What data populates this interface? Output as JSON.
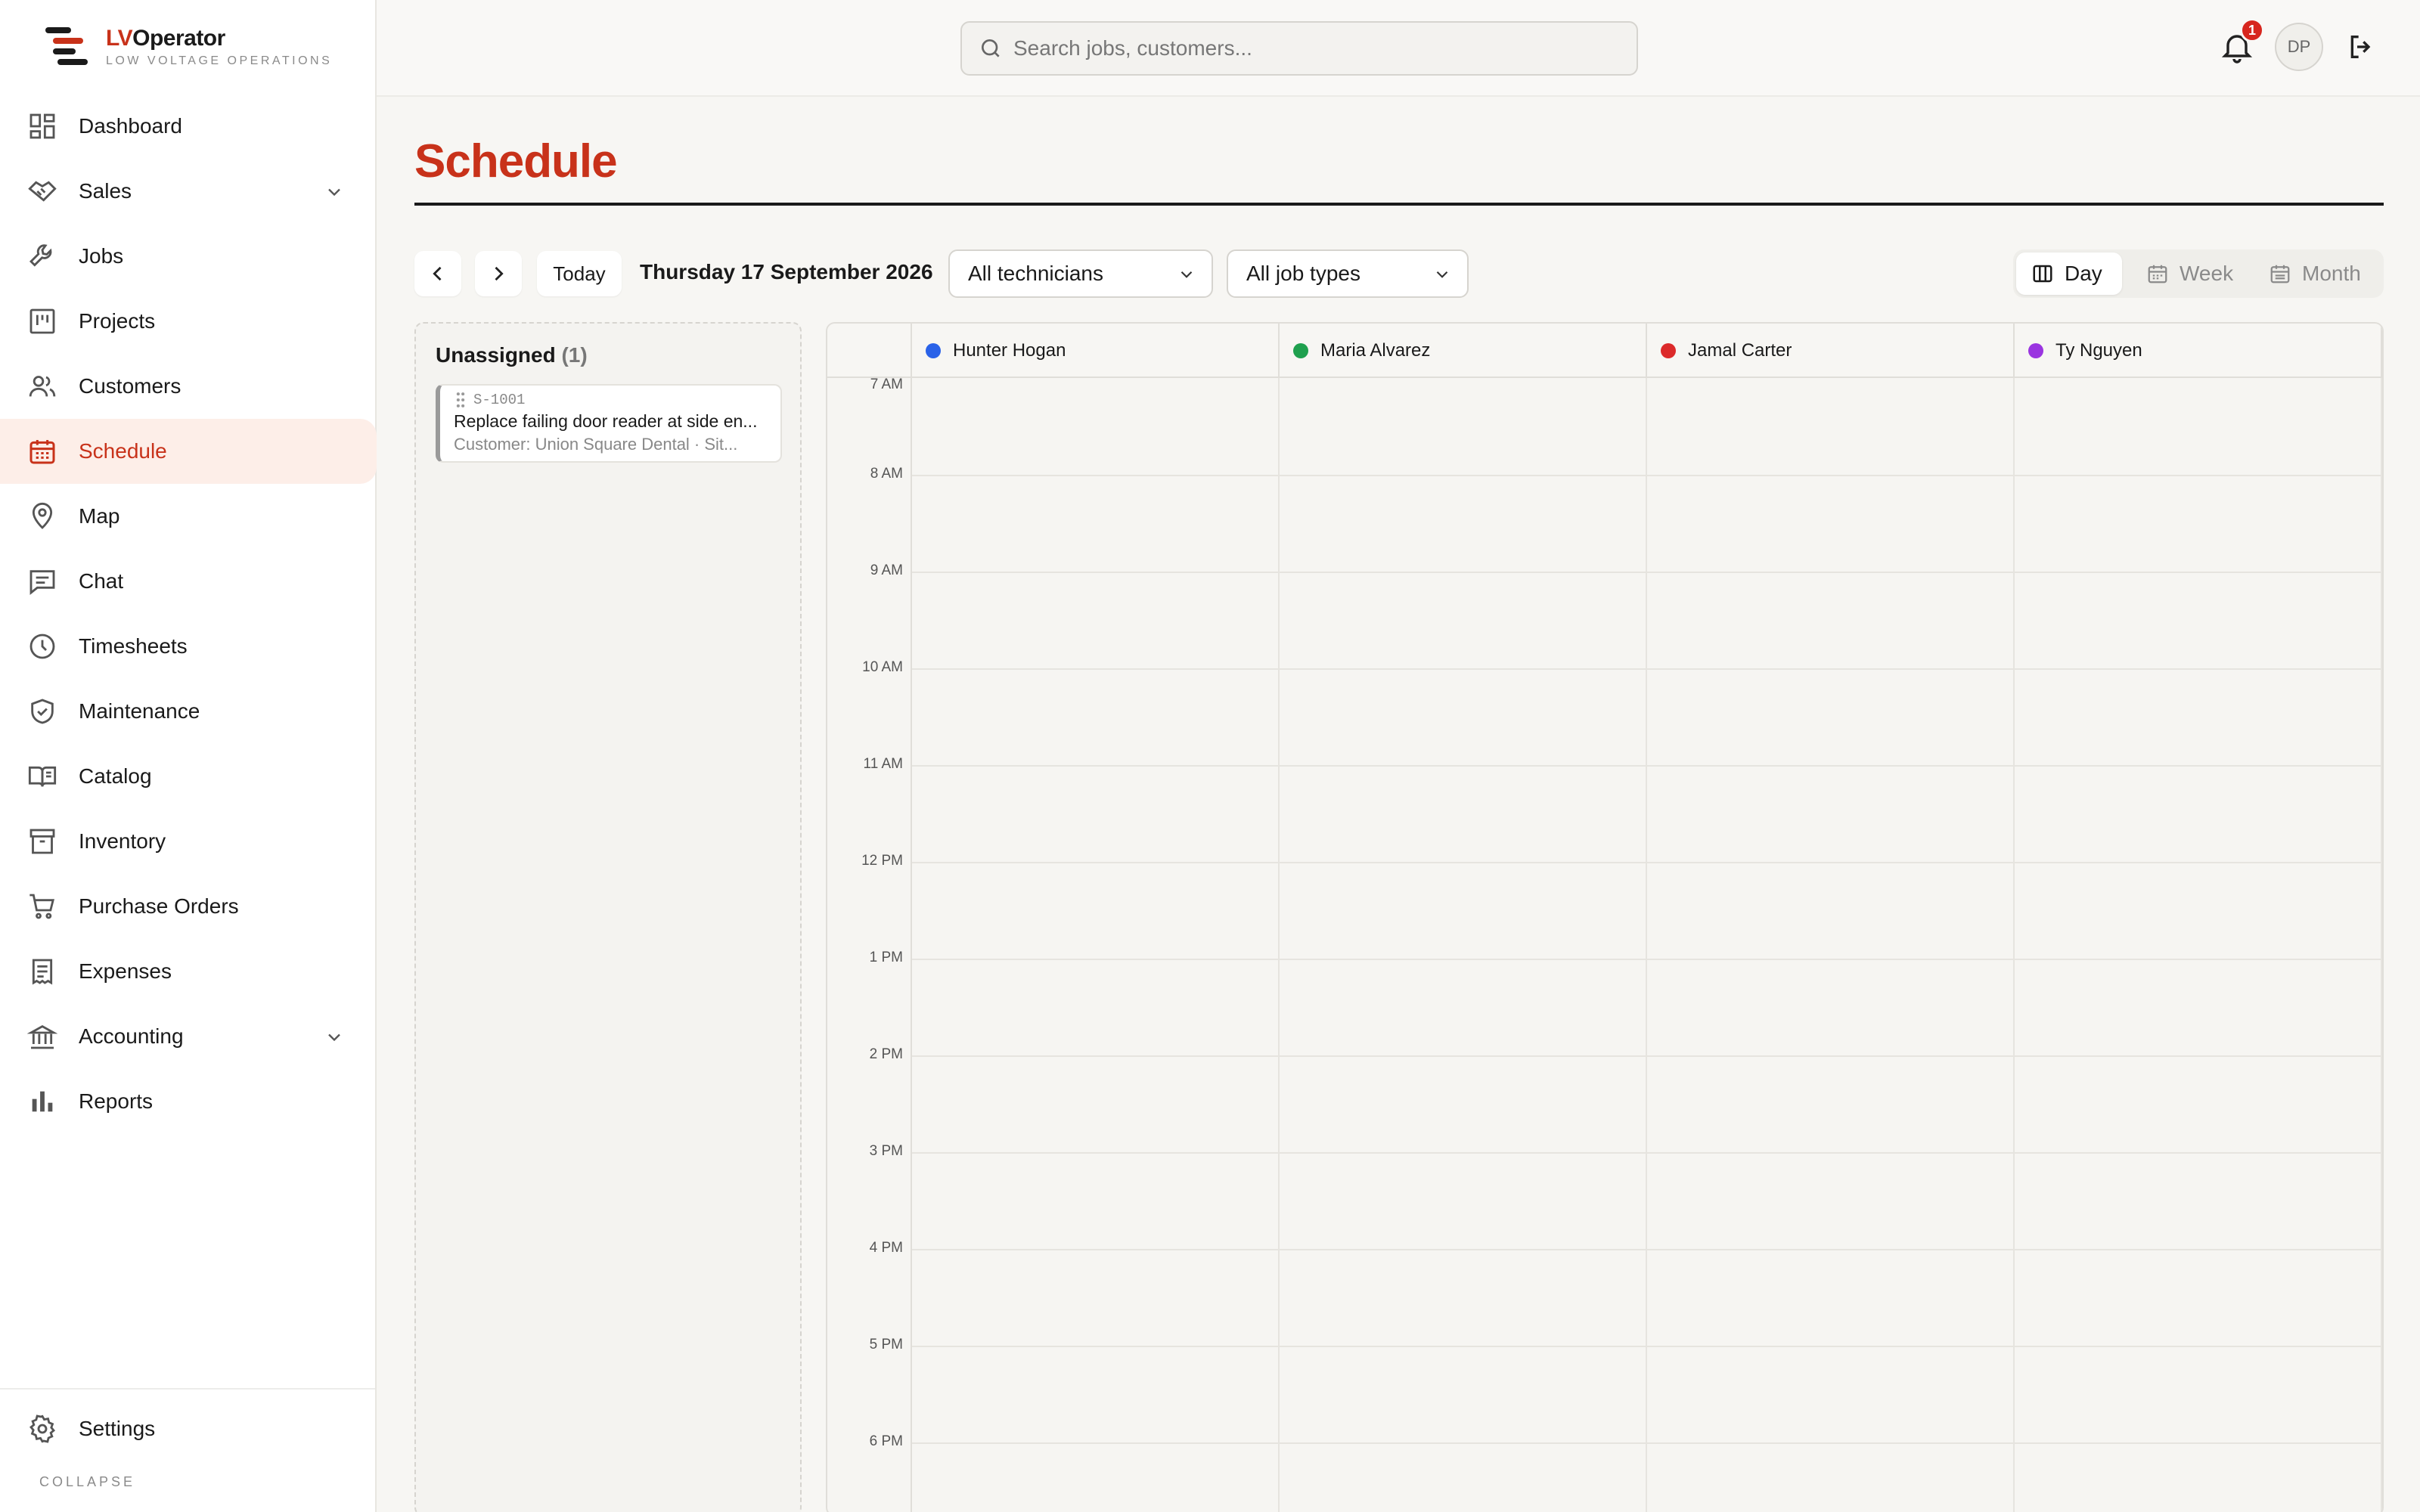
{
  "brand": {
    "name_prefix": "LV",
    "name_suffix": "Operator",
    "tagline": "LOW VOLTAGE OPERATIONS",
    "accent_color": "#c8321a"
  },
  "sidebar": {
    "items": [
      {
        "label": "Dashboard",
        "icon": "dashboard-icon"
      },
      {
        "label": "Sales",
        "icon": "handshake-icon",
        "expandable": true
      },
      {
        "label": "Jobs",
        "icon": "wrench-icon"
      },
      {
        "label": "Projects",
        "icon": "kanban-icon"
      },
      {
        "label": "Customers",
        "icon": "users-icon"
      },
      {
        "label": "Schedule",
        "icon": "calendar-icon",
        "active": true
      },
      {
        "label": "Map",
        "icon": "map-pin-icon"
      },
      {
        "label": "Chat",
        "icon": "chat-icon"
      },
      {
        "label": "Timesheets",
        "icon": "clock-icon"
      },
      {
        "label": "Maintenance",
        "icon": "shield-check-icon"
      },
      {
        "label": "Catalog",
        "icon": "book-icon"
      },
      {
        "label": "Inventory",
        "icon": "archive-icon"
      },
      {
        "label": "Purchase Orders",
        "icon": "cart-icon"
      },
      {
        "label": "Expenses",
        "icon": "receipt-icon"
      },
      {
        "label": "Accounting",
        "icon": "bank-icon",
        "expandable": true
      },
      {
        "label": "Reports",
        "icon": "bar-chart-icon"
      }
    ],
    "settings_label": "Settings",
    "collapse_label": "COLLAPSE"
  },
  "topbar": {
    "search_placeholder": "Search jobs, customers...",
    "notification_count": "1",
    "avatar_initials": "DP"
  },
  "page": {
    "title": "Schedule"
  },
  "toolbar": {
    "today_label": "Today",
    "date_label": "Thursday 17 September 2026",
    "technician_filter": "All technicians",
    "job_type_filter": "All job types",
    "views": [
      {
        "label": "Day",
        "active": true
      },
      {
        "label": "Week",
        "active": false
      },
      {
        "label": "Month",
        "active": false
      }
    ]
  },
  "unassigned": {
    "title": "Unassigned",
    "count": "(1)",
    "jobs": [
      {
        "id": "S-1001",
        "title": "Replace failing door reader at side en...",
        "subtitle": "Customer: Union Square Dental · Sit..."
      }
    ]
  },
  "calendar": {
    "technicians": [
      {
        "name": "Hunter Hogan",
        "color": "#2a62e8"
      },
      {
        "name": "Maria Alvarez",
        "color": "#1fa04e"
      },
      {
        "name": "Jamal Carter",
        "color": "#dc2a2a"
      },
      {
        "name": "Ty Nguyen",
        "color": "#9a35e0"
      }
    ],
    "hours": [
      "7 AM",
      "8 AM",
      "9 AM",
      "10 AM",
      "11 AM",
      "12 PM",
      "1 PM",
      "2 PM",
      "3 PM",
      "4 PM",
      "5 PM",
      "6 PM"
    ]
  }
}
